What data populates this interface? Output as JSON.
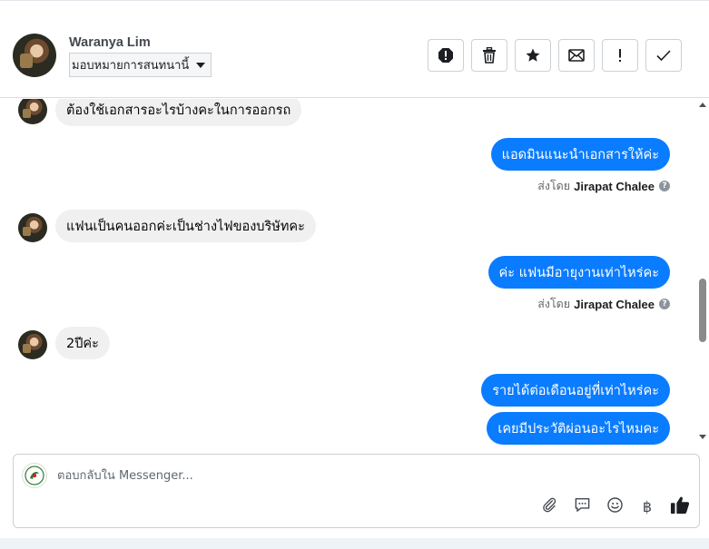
{
  "header": {
    "contact_name": "Waranya Lim",
    "label_dropdown": "มอบหมายการสนทนานี้",
    "toolbar": {
      "buttons": [
        "spam-icon",
        "trash-icon",
        "star-icon",
        "envelope-icon",
        "exclamation-icon",
        "check-icon"
      ]
    }
  },
  "thread": {
    "messages": [
      {
        "direction": "in",
        "text": "ต้องใช้เอกสารอะไรบ้างคะในการออกรถ"
      },
      {
        "direction": "out",
        "text": "แอดมินแนะนำเอกสารให้ค่ะ",
        "sent_by_prefix": "ส่งโดย",
        "sent_by_name": "Jirapat Chalee"
      },
      {
        "direction": "in",
        "text": "แฟนเป็นคนออกค่ะเป็นช่างไฟของบริษัทคะ"
      },
      {
        "direction": "out",
        "text": "ค่ะ แฟนมีอายุงานเท่าไหร่คะ",
        "sent_by_prefix": "ส่งโดย",
        "sent_by_name": "Jirapat Chalee"
      },
      {
        "direction": "in",
        "text": "2ปีค่ะ"
      },
      {
        "direction": "out",
        "text": "รายได้ต่อเดือนอยู่ที่เท่าไหร่คะ"
      },
      {
        "direction": "out",
        "text": "เคยมีประวัติผ่อนอะไรไหมคะ"
      }
    ],
    "help_glyph": "?"
  },
  "composer": {
    "placeholder": "ตอบกลับใน Messenger...",
    "value": "",
    "baht_symbol": "฿",
    "tools": [
      "paperclip-icon",
      "saved-reply-icon",
      "emoji-icon",
      "baht-icon",
      "thumbs-up-icon"
    ]
  },
  "colors": {
    "outgoing_bubble": "#0a7cff",
    "incoming_bubble": "#f0f0f0",
    "border": "#ccd0d5"
  }
}
